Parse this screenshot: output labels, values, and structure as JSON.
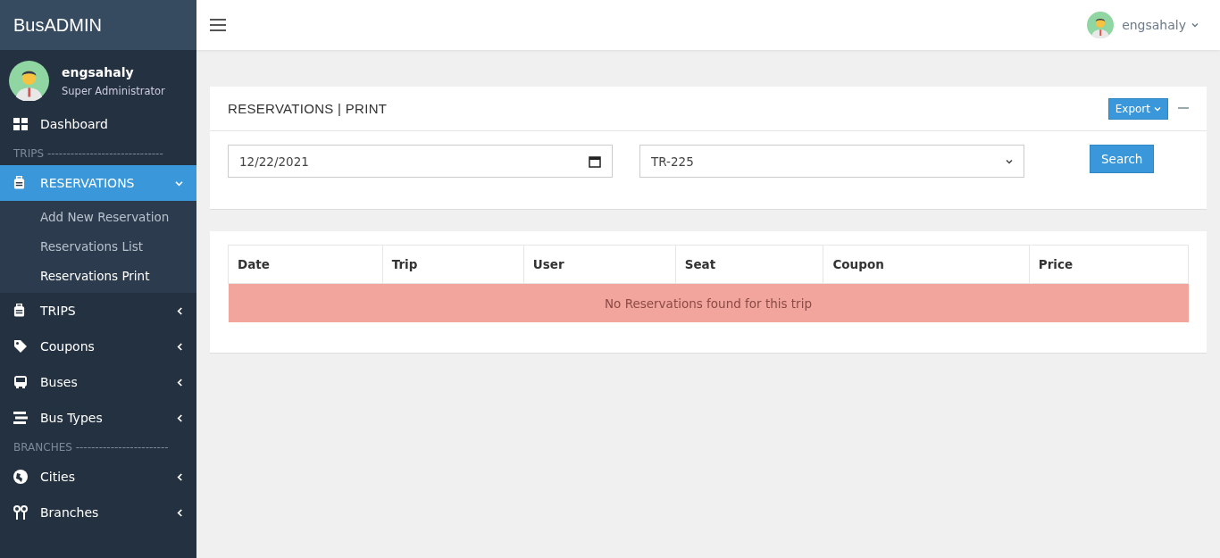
{
  "sidebar": {
    "brand": "BusADMIN",
    "user": {
      "name": "engsahaly",
      "role": "Super Administrator"
    },
    "items": [
      {
        "kind": "link",
        "label": "Dashboard",
        "selected": false
      },
      {
        "kind": "header",
        "label": "TRIPS ------------------------------"
      },
      {
        "kind": "menu",
        "label": "RESERVATIONS",
        "selected": true,
        "expanded": true,
        "children": [
          {
            "label": "Add New Reservation",
            "selected": false
          },
          {
            "label": "Reservations List",
            "selected": false
          },
          {
            "label": "Reservations Print",
            "selected": true
          }
        ]
      },
      {
        "kind": "menu",
        "label": "TRIPS",
        "selected": false,
        "expanded": false
      },
      {
        "kind": "menu",
        "label": "Coupons",
        "selected": false,
        "expanded": false
      },
      {
        "kind": "menu",
        "label": "Buses",
        "selected": false,
        "expanded": false
      },
      {
        "kind": "menu",
        "label": "Bus Types",
        "selected": false,
        "expanded": false
      },
      {
        "kind": "header",
        "label": "BRANCHES ------------------------"
      },
      {
        "kind": "menu",
        "label": "Cities",
        "selected": false,
        "expanded": false
      },
      {
        "kind": "menu",
        "label": "Branches",
        "selected": false,
        "expanded": false
      }
    ]
  },
  "topbar": {
    "user_name": "engsahaly"
  },
  "filter_panel": {
    "title": "RESERVATIONS | PRINT",
    "export_button": "Export",
    "date_field": {
      "value": "12/22/2021"
    },
    "trip_select": {
      "value": "TR-225"
    },
    "search_button": "Search"
  },
  "results_panel": {
    "table": {
      "columns": [
        "Date",
        "Trip",
        "User",
        "Seat",
        "Coupon",
        "Price"
      ],
      "empty_message": "No Reservations found for this trip"
    }
  }
}
